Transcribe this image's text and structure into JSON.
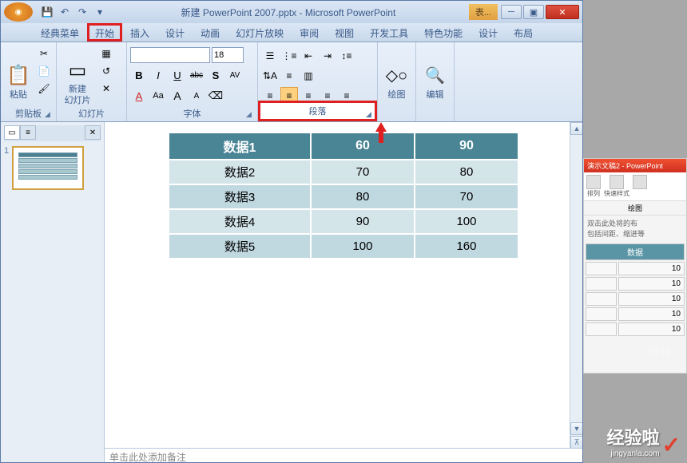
{
  "window": {
    "title": "新建 PowerPoint 2007.pptx - Microsoft PowerPoint",
    "context_tab": "表..."
  },
  "qat": {
    "save": "💾",
    "undo": "↶",
    "redo": "↷",
    "dropdown": "▾"
  },
  "tabs": {
    "items": [
      {
        "label": "经典菜单"
      },
      {
        "label": "开始"
      },
      {
        "label": "插入"
      },
      {
        "label": "设计"
      },
      {
        "label": "动画"
      },
      {
        "label": "幻灯片放映"
      },
      {
        "label": "审阅"
      },
      {
        "label": "视图"
      },
      {
        "label": "开发工具"
      },
      {
        "label": "特色功能"
      },
      {
        "label": "设计"
      },
      {
        "label": "布局"
      }
    ]
  },
  "ribbon": {
    "clipboard": {
      "label": "剪贴板",
      "paste": "粘贴"
    },
    "slides": {
      "label": "幻灯片",
      "new_slide": "新建\n幻灯片"
    },
    "font": {
      "label": "字体",
      "size": "18",
      "bold": "B",
      "italic": "I",
      "underline": "U",
      "strike": "abc",
      "shadow": "S",
      "spacing": "AV",
      "color": "A",
      "case": "Aa",
      "grow": "A",
      "shrink": "A",
      "clear": "⌫"
    },
    "paragraph": {
      "label": "段落"
    },
    "drawing": {
      "label": "绘图"
    },
    "editing": {
      "label": "编辑"
    }
  },
  "thumb": {
    "num": "1"
  },
  "chart_data": {
    "type": "table",
    "headers": [
      "数据1",
      "60",
      "90"
    ],
    "rows": [
      [
        "数据2",
        "70",
        "80"
      ],
      [
        "数据3",
        "80",
        "70"
      ],
      [
        "数据4",
        "90",
        "100"
      ],
      [
        "数据5",
        "100",
        "160"
      ]
    ]
  },
  "notes": {
    "placeholder": "单击此处添加备注"
  },
  "side": {
    "title": "演示文稿2 - PowerPoint",
    "btn1": "排列",
    "btn2": "快速样式",
    "group": "绘图",
    "hint": "双击此处将的布\n包括间距、缩进等",
    "header": "数据",
    "vals": [
      "10",
      "10",
      "10",
      "10",
      "10"
    ]
  },
  "watermark": {
    "main": "经验啦",
    "sub": "jingyanla.com",
    "check": "✓",
    "bg": "⊙ 经验"
  }
}
